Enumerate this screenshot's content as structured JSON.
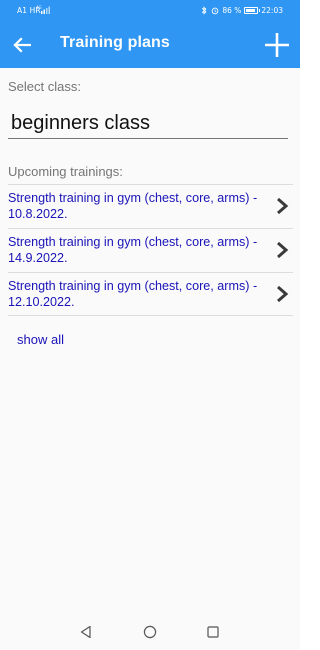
{
  "status_bar": {
    "carrier": "A1 HR",
    "battery_text": "86 %",
    "battery_level": 0.86,
    "time": "22:03",
    "icons": [
      "signal-icon",
      "bluetooth-icon",
      "alarm-icon",
      "battery-icon"
    ]
  },
  "app_bar": {
    "title": "Training plans",
    "back_icon": "arrow-left-icon",
    "add_icon": "plus-icon",
    "background": "#2f96f3"
  },
  "class_section": {
    "label": "Select class:",
    "selected_value": "beginners class"
  },
  "trainings_section": {
    "label": "Upcoming trainings:",
    "items": [
      {
        "text": "Strength training in gym (chest, core, arms) - 10.8.2022."
      },
      {
        "text": "Strength training in gym (chest, core, arms) - 14.9.2022."
      },
      {
        "text": "Strength training in gym (chest, core, arms) - 12.10.2022."
      }
    ],
    "show_all_label": "show all",
    "link_color": "#1a13b8"
  },
  "nav_bar": {
    "icons": [
      "back-triangle-icon",
      "home-circle-icon",
      "recents-square-icon"
    ]
  }
}
